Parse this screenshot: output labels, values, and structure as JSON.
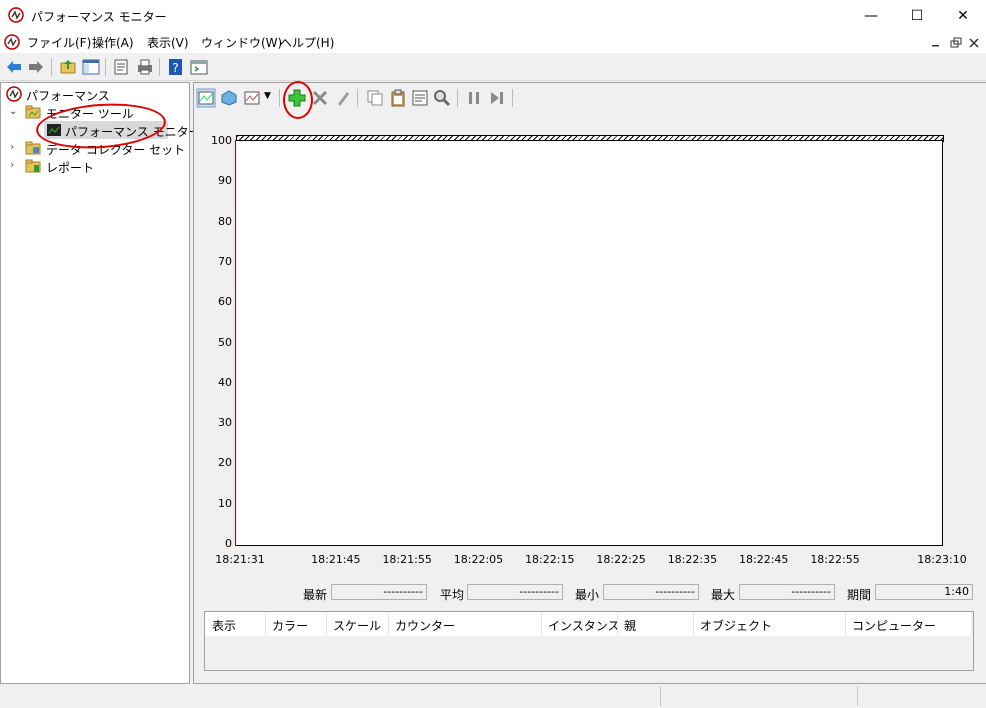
{
  "window": {
    "title": "パフォーマンス モニター",
    "controls": {
      "minimize": "—",
      "maximize": "☐",
      "close": "✕"
    }
  },
  "menu": {
    "items": [
      "ファイル(F)",
      "操作(A)",
      "表示(V)",
      "ウィンドウ(W)",
      "ヘルプ(H)"
    ]
  },
  "tree": {
    "root": "パフォーマンス",
    "monitor_tools": "モニター ツール",
    "perfmon": "パフォーマンス モニター",
    "data_collector_sets": "データ コレクター セット",
    "reports": "レポート"
  },
  "chart_data": {
    "type": "line",
    "ylim": [
      0,
      100
    ],
    "y_ticks": [
      "100",
      "90",
      "80",
      "70",
      "60",
      "50",
      "40",
      "30",
      "20",
      "10",
      "0"
    ],
    "x_ticks": [
      "18:21:31",
      "18:21:45",
      "18:21:55",
      "18:22:05",
      "18:22:15",
      "18:22:25",
      "18:22:35",
      "18:22:45",
      "18:22:55",
      "18:23:10"
    ],
    "series": []
  },
  "stats": {
    "last_label": "最新",
    "last_value": "----------",
    "avg_label": "平均",
    "avg_value": "----------",
    "min_label": "最小",
    "min_value": "----------",
    "max_label": "最大",
    "max_value": "----------",
    "duration_label": "期間",
    "duration_value": "1:40"
  },
  "legend": {
    "columns": [
      "表示",
      "カラー",
      "スケール",
      "カウンター",
      "インスタンス",
      "親",
      "オブジェクト",
      "コンピューター"
    ]
  },
  "colors": {
    "accent_red": "#e00000",
    "add_green": "#2db62d"
  }
}
